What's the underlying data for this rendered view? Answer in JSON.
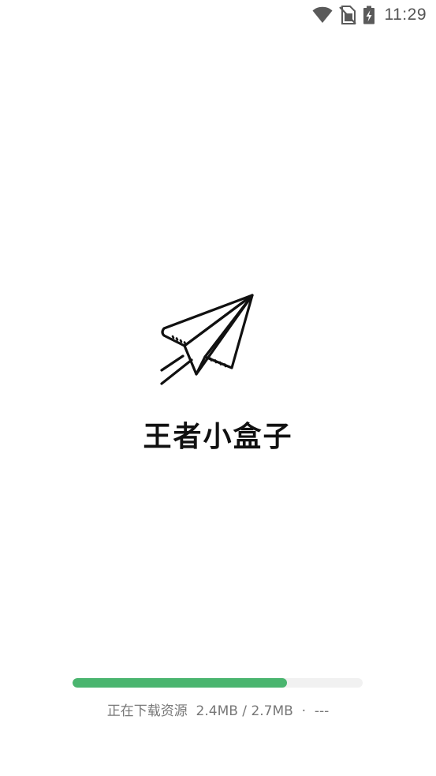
{
  "status_bar": {
    "time": "11:29",
    "icons": [
      "wifi-icon",
      "no-sim-icon",
      "battery-charging-icon"
    ]
  },
  "splash": {
    "logo_icon": "paper-plane-icon",
    "app_name": "王者小盒子"
  },
  "download": {
    "status_text": "正在下载资源",
    "downloaded": "2.4MB",
    "total": "2.7MB",
    "speed": "---",
    "progress_fraction": 0.74,
    "fill_color": "#4ab56f",
    "track_color": "#f1f1f1"
  }
}
